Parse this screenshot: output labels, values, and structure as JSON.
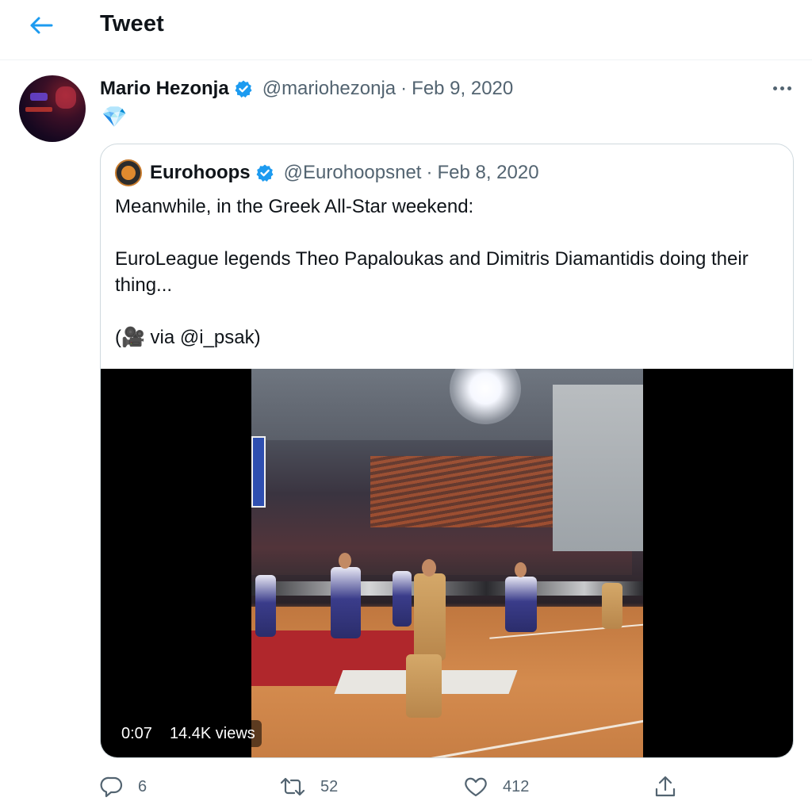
{
  "header": {
    "title": "Tweet",
    "back_icon": "arrow-left-icon"
  },
  "tweet": {
    "author_name": "Mario Hezonja",
    "author_handle": "@mariohezonja",
    "separator": "·",
    "date": "Feb 9, 2020",
    "text": "💎",
    "verified": true
  },
  "quoted": {
    "author_name": "Eurohoops",
    "author_handle": "@Eurohoopsnet",
    "separator": "·",
    "date": "Feb 8, 2020",
    "lines": [
      "Meanwhile, in the Greek All-Star weekend:",
      "EuroLeague legends Theo Papaloukas and Dimitris Diamantidis doing their thing...",
      "(🎥 via @i_psak)"
    ],
    "video": {
      "time": "0:07",
      "views": "14.4K views"
    }
  },
  "actions": {
    "replies": "6",
    "retweets": "52",
    "likes": "412"
  },
  "colors": {
    "accent": "#1d9bf0",
    "text_primary": "#0f1419",
    "text_secondary": "#536471",
    "border": "#cfd9de"
  }
}
